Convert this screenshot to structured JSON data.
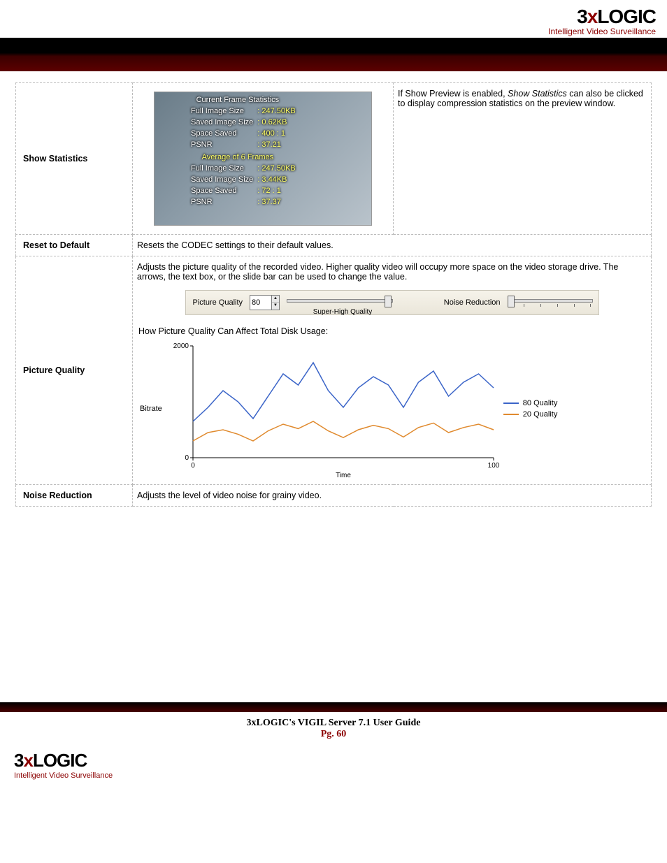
{
  "brand": {
    "three": "3",
    "x": "x",
    "rest": "LOGIC",
    "tagline": "Intelligent Video Surveillance"
  },
  "rows": {
    "show_stats": {
      "label": "Show Statistics",
      "desc_pre": "If Show Preview is enabled, ",
      "desc_em": "Show Statistics",
      "desc_post": " can also be clicked to display compression statistics on the preview window.",
      "overlay": {
        "current_hdr": "Current Frame Statistics",
        "full_img": "Full Image Size",
        "full_img_v": ": 247.50KB",
        "saved_img": "Saved Image Size",
        "saved_img_v": ": 0.62KB",
        "space": "Space Saved",
        "space_v": ": 400 : 1",
        "psnr": "PSNR",
        "psnr_v": ": 37.21",
        "avg_hdr": "Average of 6 Frames",
        "a_full_img_v": ": 247.50KB",
        "a_saved_img_v": ": 3.44KB",
        "a_space_v": ": 72 : 1",
        "a_psnr_v": ": 37.37"
      }
    },
    "reset": {
      "label": "Reset to Default",
      "desc": "Resets the CODEC settings to their default values."
    },
    "pq": {
      "label": "Picture Quality",
      "desc": "Adjusts the picture quality of the recorded video. Higher quality video will occupy more space on the video storage drive. The arrows, the text box, or the slide bar can be used to change the value.",
      "ctrl": {
        "pq_label": "Picture Quality",
        "value": "80",
        "sub": "Super-High Quality",
        "nr_label": "Noise Reduction"
      },
      "chart_intro": "How Picture Quality Can Affect Total Disk Usage:"
    },
    "nr": {
      "label": "Noise Reduction",
      "desc": "Adjusts the level of video noise for grainy video."
    }
  },
  "chart_data": {
    "type": "line",
    "xlabel": "Time",
    "ylabel": "Bitrate",
    "xlim": [
      0,
      100
    ],
    "ylim": [
      0,
      2000
    ],
    "xticks": [
      0,
      100
    ],
    "yticks": [
      0,
      2000
    ],
    "series": [
      {
        "name": "80 Quality",
        "color": "#3a64c8",
        "x": [
          0,
          5,
          10,
          15,
          20,
          25,
          30,
          35,
          40,
          45,
          50,
          55,
          60,
          65,
          70,
          75,
          80,
          85,
          90,
          95,
          100
        ],
        "y": [
          650,
          900,
          1200,
          1000,
          700,
          1100,
          1500,
          1300,
          1700,
          1200,
          900,
          1250,
          1450,
          1300,
          900,
          1350,
          1550,
          1100,
          1350,
          1500,
          1250
        ]
      },
      {
        "name": "20 Quality",
        "color": "#e08a2e",
        "x": [
          0,
          5,
          10,
          15,
          20,
          25,
          30,
          35,
          40,
          45,
          50,
          55,
          60,
          65,
          70,
          75,
          80,
          85,
          90,
          95,
          100
        ],
        "y": [
          300,
          450,
          500,
          420,
          300,
          480,
          600,
          520,
          650,
          480,
          360,
          500,
          580,
          520,
          370,
          540,
          620,
          450,
          540,
          600,
          500
        ]
      }
    ]
  },
  "footer": {
    "title": "3xLOGIC's VIGIL Server 7.1 User Guide",
    "page": "Pg. 60"
  }
}
